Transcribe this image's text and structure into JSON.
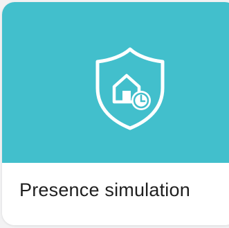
{
  "card": {
    "title": "Presence simulation",
    "icon": "shield-house-clock-icon",
    "accent_color": "#42bfcc",
    "icon_color": "#ffffff"
  }
}
